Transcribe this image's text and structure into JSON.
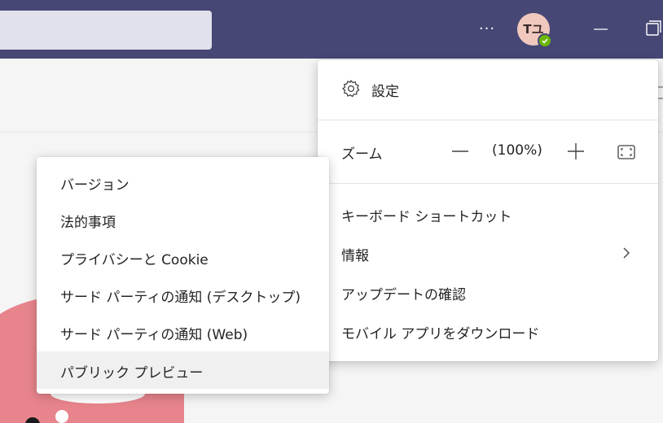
{
  "titlebar": {
    "more_label": "···",
    "avatar_initials": "Tユ"
  },
  "main_menu": {
    "settings_label": "設定",
    "zoom_label": "ズーム",
    "zoom_value": "(100%)",
    "keyboard_shortcuts_label": "キーボード ショートカット",
    "about_label": "情報",
    "check_updates_label": "アップデートの確認",
    "download_mobile_label": "モバイル アプリをダウンロード"
  },
  "sub_menu": {
    "items": [
      {
        "label": "バージョン"
      },
      {
        "label": "法的事項"
      },
      {
        "label": "プライバシーと Cookie"
      },
      {
        "label": "サード パーティの通知 (デスクトップ)"
      },
      {
        "label": "サード パーティの通知 (Web)"
      },
      {
        "label": "パブリック プレビュー"
      }
    ]
  },
  "colors": {
    "titlebar": "#464775",
    "menu_bg": "#ffffff",
    "hover_bg": "#f0f0f0",
    "presence": "#6bb700",
    "avatar_bg": "#f0c8be",
    "illustration_pink": "#e8848c"
  },
  "icons": {
    "settings": "gear-icon",
    "zoom_out": "minus-icon",
    "zoom_in": "plus-icon",
    "fullscreen": "fullscreen-icon",
    "submenu": "chevron-right-icon",
    "minimize": "minimize-icon",
    "restore": "restore-icon",
    "presence": "check-icon"
  }
}
